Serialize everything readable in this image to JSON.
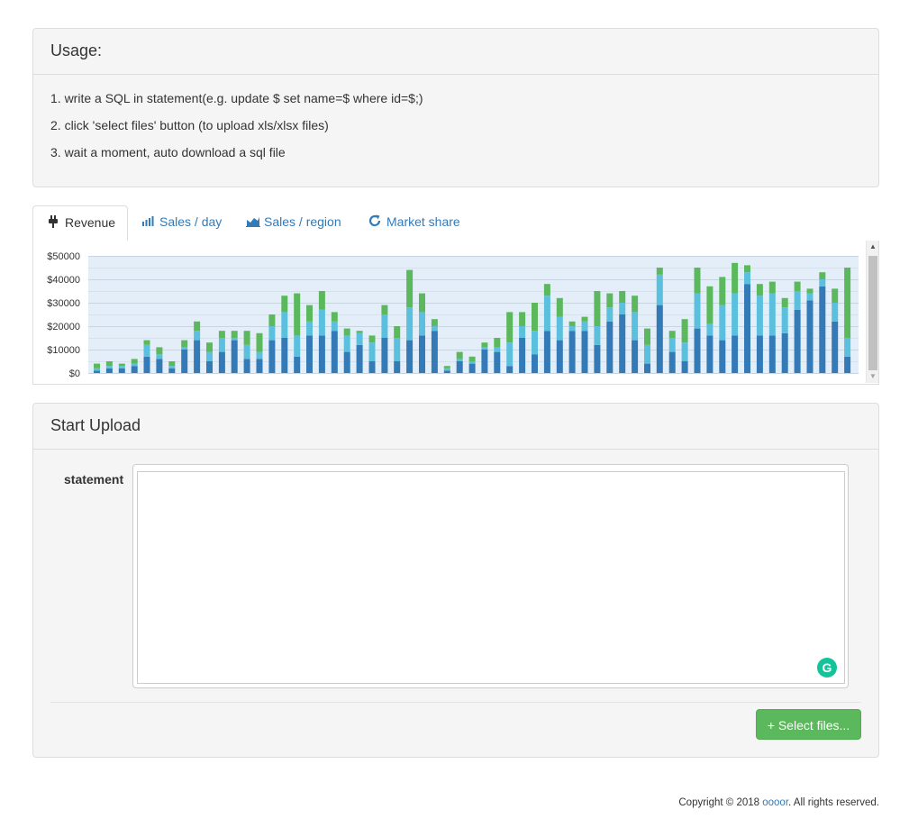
{
  "usage": {
    "title": "Usage:",
    "steps": [
      "1. write a SQL in statement(e.g. update $ set name=$ where id=$;)",
      "2. click 'select files' button (to upload xls/xlsx files)",
      "3. wait a moment, auto download a sql file"
    ]
  },
  "tabs": [
    {
      "label": "Revenue",
      "icon": "plug-icon",
      "active": true
    },
    {
      "label": "Sales / day",
      "icon": "bar-chart-icon",
      "active": false
    },
    {
      "label": "Sales / region",
      "icon": "area-chart-icon",
      "active": false
    },
    {
      "label": "Market share",
      "icon": "refresh-icon",
      "active": false
    }
  ],
  "chart_data": {
    "type": "bar",
    "stacked": true,
    "ylim": [
      0,
      50000
    ],
    "y_ticks": [
      "$0",
      "$10000",
      "$20000",
      "$30000",
      "$40000",
      "$50000"
    ],
    "grid": true,
    "series": [
      {
        "color": "#337ab7",
        "values": [
          1000,
          2000,
          2000,
          3000,
          7000,
          6000,
          2000,
          10000,
          14000,
          5000,
          9000,
          14000,
          6000,
          6000,
          14000,
          15000,
          7000,
          16000,
          16000,
          18000,
          9000,
          12000,
          5000,
          15000,
          5000,
          14000,
          16000,
          18000,
          1000,
          5000,
          4000,
          10000,
          9000,
          3000,
          15000,
          8000,
          18000,
          14000,
          18000,
          18000,
          12000,
          22000,
          25000,
          14000,
          4000,
          29000,
          9000,
          5000,
          19000,
          16000,
          14000,
          16000,
          38000,
          16000,
          16000,
          17000,
          27000,
          31000,
          37000,
          22000,
          7000
        ]
      },
      {
        "color": "#5bc0de",
        "values": [
          1000,
          1000,
          1000,
          1000,
          5000,
          2000,
          1000,
          1000,
          4000,
          4000,
          6000,
          1000,
          6000,
          3000,
          6000,
          11000,
          9000,
          6000,
          11000,
          4000,
          7000,
          5000,
          8000,
          10000,
          10000,
          14000,
          10000,
          2000,
          1000,
          1000,
          1000,
          1000,
          2000,
          10000,
          5000,
          10000,
          15000,
          10000,
          2000,
          4000,
          8000,
          6000,
          5000,
          12000,
          8000,
          13000,
          6000,
          8000,
          15000,
          5000,
          15000,
          18000,
          5000,
          17000,
          18000,
          11000,
          8000,
          3000,
          3000,
          8000,
          8000
        ]
      },
      {
        "color": "#5cb85c",
        "values": [
          2000,
          2000,
          1000,
          2000,
          2000,
          3000,
          2000,
          3000,
          4000,
          4000,
          3000,
          3000,
          6000,
          8000,
          5000,
          7000,
          18000,
          7000,
          8000,
          4000,
          3000,
          1000,
          3000,
          4000,
          5000,
          16000,
          8000,
          3000,
          1000,
          3000,
          2000,
          2000,
          4000,
          13000,
          6000,
          12000,
          5000,
          8000,
          2000,
          2000,
          15000,
          6000,
          5000,
          7000,
          7000,
          3000,
          3000,
          10000,
          11000,
          16000,
          12000,
          13000,
          3000,
          5000,
          5000,
          4000,
          4000,
          2000,
          3000,
          6000,
          30000
        ]
      }
    ]
  },
  "upload": {
    "title": "Start Upload",
    "statement_label": "statement",
    "statement_value": "",
    "grammarly_glyph": "G",
    "select_button": "+ Select files..."
  },
  "footer": {
    "prefix": "Copyright © 2018 ",
    "link": "oooor",
    "suffix": ". All rights reserved."
  }
}
